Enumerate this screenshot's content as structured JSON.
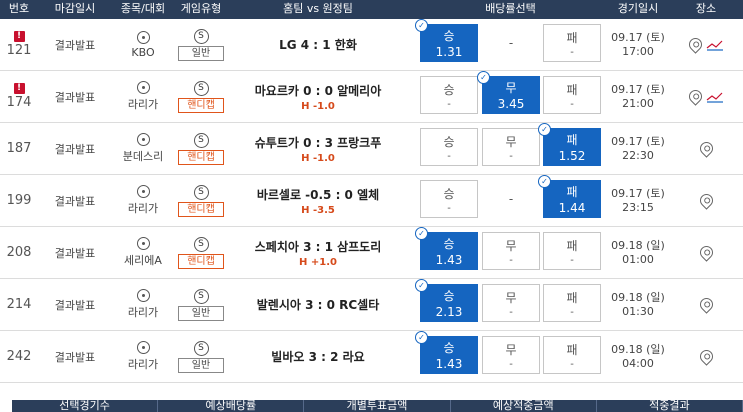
{
  "header": {
    "no": "번호",
    "deadline": "마감일시",
    "sport": "종목/대회",
    "game_type": "게임유형",
    "match": "홈팀 vs 원정팀",
    "odds": "배당률선택",
    "date": "경기일시",
    "venue": "장소"
  },
  "rows": [
    {
      "no": "121",
      "warn": "!",
      "deadline": "결과발표",
      "league": "KBO",
      "s": "S",
      "type": "일반",
      "match": "LG 4 : 1 한화",
      "handicap": "",
      "o1_label": "승",
      "o1_value": "1.31",
      "o2_label": "-",
      "o2_value": "",
      "o3_label": "패",
      "o3_value": "-",
      "date1": "09.17 (토)",
      "date2": "17:00"
    },
    {
      "no": "174",
      "warn": "!",
      "deadline": "결과발표",
      "league": "라리가",
      "s": "S",
      "type": "핸디캡",
      "match": "마요르카 0 : 0 알메리아",
      "handicap": "H -1.0",
      "o1_label": "승",
      "o1_value": "-",
      "o2_label": "무",
      "o2_value": "3.45",
      "o3_label": "패",
      "o3_value": "-",
      "date1": "09.17 (토)",
      "date2": "21:00"
    },
    {
      "no": "187",
      "warn": "",
      "deadline": "결과발표",
      "league": "분데스리",
      "s": "S",
      "type": "핸디캡",
      "match": "슈투트가 0 : 3 프랑크푸",
      "handicap": "H -1.0",
      "o1_label": "승",
      "o1_value": "-",
      "o2_label": "무",
      "o2_value": "-",
      "o3_label": "패",
      "o3_value": "1.52",
      "date1": "09.17 (토)",
      "date2": "22:30"
    },
    {
      "no": "199",
      "warn": "",
      "deadline": "결과발표",
      "league": "라리가",
      "s": "S",
      "type": "핸디캡",
      "match": "바르셀로 -0.5 : 0 엘체",
      "handicap": "H -3.5",
      "o1_label": "승",
      "o1_value": "-",
      "o2_label": "-",
      "o2_value": "",
      "o3_label": "패",
      "o3_value": "1.44",
      "date1": "09.17 (토)",
      "date2": "23:15"
    },
    {
      "no": "208",
      "warn": "",
      "deadline": "결과발표",
      "league": "세리에A",
      "s": "S",
      "type": "핸디캡",
      "match": "스페치아 3 : 1 삼프도리",
      "handicap": "H +1.0",
      "o1_label": "승",
      "o1_value": "1.43",
      "o2_label": "무",
      "o2_value": "-",
      "o3_label": "패",
      "o3_value": "-",
      "date1": "09.18 (일)",
      "date2": "01:00"
    },
    {
      "no": "214",
      "warn": "",
      "deadline": "결과발표",
      "league": "라리가",
      "s": "S",
      "type": "일반",
      "match": "발렌시아 3 : 0 RC셀타",
      "handicap": "",
      "o1_label": "승",
      "o1_value": "2.13",
      "o2_label": "무",
      "o2_value": "-",
      "o3_label": "패",
      "o3_value": "-",
      "date1": "09.18 (일)",
      "date2": "01:30"
    },
    {
      "no": "242",
      "warn": "",
      "deadline": "결과발표",
      "league": "라리가",
      "s": "S",
      "type": "일반",
      "match": "빌바오 3 : 2 라요",
      "handicap": "",
      "o1_label": "승",
      "o1_value": "1.43",
      "o2_label": "무",
      "o2_value": "-",
      "o3_label": "패",
      "o3_value": "-",
      "date1": "09.18 (일)",
      "date2": "04:00"
    }
  ],
  "footer": {
    "tab1": "선택경기수",
    "tab2": "예상배당률",
    "tab3": "개별투표금액",
    "tab4": "예상적중금액",
    "tab5": "적중결과"
  }
}
